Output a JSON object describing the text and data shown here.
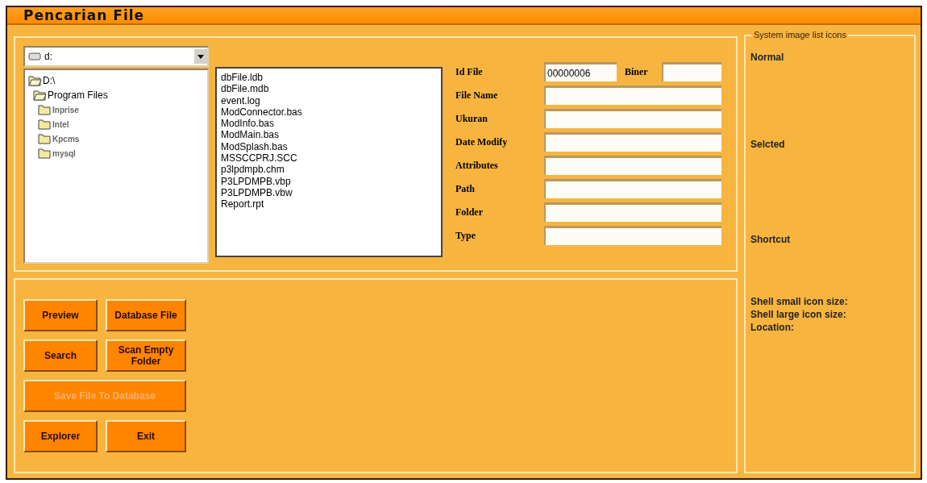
{
  "window": {
    "title": "Pencarian File"
  },
  "drive": {
    "value": "d:"
  },
  "tree": [
    {
      "label": "D:\\",
      "expanded": true,
      "children": [
        {
          "label": "Program Files",
          "expanded": true,
          "children": [
            {
              "label": "Inprise",
              "expanded": false
            },
            {
              "label": "Intel",
              "expanded": false
            },
            {
              "label": "Kpcms",
              "expanded": false
            },
            {
              "label": "mysql",
              "expanded": false
            }
          ]
        }
      ]
    }
  ],
  "files": [
    "dbFile.ldb",
    "dbFile.mdb",
    "event.log",
    "ModConnector.bas",
    "ModInfo.bas",
    "ModMain.bas",
    "ModSplash.bas",
    "MSSCCPRJ.SCC",
    "p3lpdmpb.chm",
    "P3LPDMPB.vbp",
    "P3LPDMPB.vbw",
    "Report.rpt"
  ],
  "form": {
    "id_file": {
      "label": "Id File",
      "value": "00000006"
    },
    "biner": {
      "label": "Biner"
    },
    "fields": [
      {
        "label": "File Name"
      },
      {
        "label": "Ukuran"
      },
      {
        "label": "Date Modify"
      },
      {
        "label": "Attributes"
      },
      {
        "label": "Path"
      },
      {
        "label": "Folder"
      },
      {
        "label": "Type"
      }
    ]
  },
  "buttons": [
    {
      "label": "Preview",
      "disabled": false,
      "wide": false
    },
    {
      "label": "Database File",
      "disabled": false,
      "wide": false
    },
    {
      "label": "Search",
      "disabled": false,
      "wide": false
    },
    {
      "label": "Scan Empty Folder",
      "disabled": false,
      "wide": false
    },
    {
      "label": "Save File To Database",
      "disabled": true,
      "wide": true
    },
    {
      "label": "Explorer",
      "disabled": false,
      "wide": false
    },
    {
      "label": "Exit",
      "disabled": false,
      "wide": false
    }
  ],
  "icons_panel": {
    "title": "System image list icons",
    "sections": [
      {
        "label": "Normal"
      },
      {
        "label": "Selcted"
      },
      {
        "label": "Shortcut"
      }
    ],
    "info": [
      "Shell small icon size:",
      "Shell large icon size:",
      "Location:"
    ]
  }
}
